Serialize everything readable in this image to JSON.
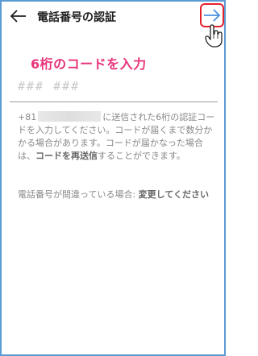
{
  "header": {
    "title": "電話番号の認証",
    "back_icon": "arrow-left-icon",
    "next_icon": "arrow-right-icon",
    "next_border_color": "#e5212d",
    "next_arrow_color": "#4a90e2"
  },
  "annotation": {
    "text": "6桁のコードを入力",
    "color": "#e8327a"
  },
  "code_field": {
    "placeholder": "### ###",
    "value": ""
  },
  "info": {
    "phone_prefix": "+81",
    "part1": "に送信された6桁の認証コードを入力してください。コードが届くまで数分かかる場合があります。コードが届かなった場合は、",
    "resend_link": "コードを再送信",
    "part2": "することができます。"
  },
  "wrong_number": {
    "text": "電話番号が間違っている場合: ",
    "link": "変更してください"
  },
  "colors": {
    "frame_border": "#5b9bd5",
    "text_muted": "#888888"
  }
}
